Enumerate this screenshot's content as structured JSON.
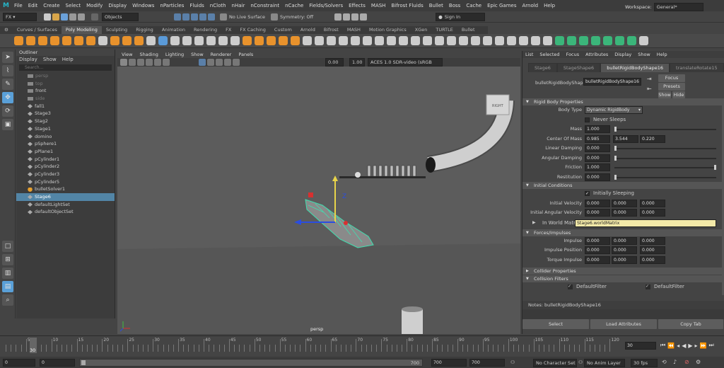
{
  "menubar": [
    "File",
    "Edit",
    "Create",
    "Select",
    "Modify",
    "Display",
    "Windows",
    "nParticles",
    "Fluids",
    "nCloth",
    "nHair",
    "nConstraint",
    "nCache",
    "Fields/Solvers",
    "Effects",
    "MASH",
    "Bifrost Fluids",
    "Bullet",
    "Boss",
    "Cache",
    "Epic Games",
    "Arnold",
    "Help"
  ],
  "workspace": {
    "label": "Workspace:",
    "value": "General*"
  },
  "status": {
    "mode": "FX",
    "objects": "Objects",
    "live_surface": "No Live Surface",
    "symmetry": "Symmetry: Off",
    "sign_in": "Sign In"
  },
  "shelf_tabs": [
    "Curves / Surfaces",
    "Poly Modeling",
    "Sculpting",
    "Rigging",
    "Animation",
    "Rendering",
    "FX",
    "FX Caching",
    "Custom",
    "Arnold",
    "Bifrost",
    "MASH",
    "Motion Graphics",
    "XGen",
    "TURTLE",
    "Bullet"
  ],
  "shelf_active": "Poly Modeling",
  "outliner": {
    "title": "Outliner",
    "menus": [
      "Display",
      "Show",
      "Help"
    ],
    "search_placeholder": "Search...",
    "items": [
      {
        "label": "persp",
        "dim": true
      },
      {
        "label": "top",
        "dim": true
      },
      {
        "label": "front",
        "dim": false
      },
      {
        "label": "side",
        "dim": true
      },
      {
        "label": "fall1",
        "dim": false
      },
      {
        "label": "Stage3",
        "dim": false
      },
      {
        "label": "Stag2",
        "dim": false
      },
      {
        "label": "Stage1",
        "dim": false
      },
      {
        "label": "domino",
        "dim": false
      },
      {
        "label": "pSphere1",
        "dim": false
      },
      {
        "label": "pPlane1",
        "dim": false
      },
      {
        "label": "pCylinder1",
        "dim": false
      },
      {
        "label": "pCylinder2",
        "dim": false
      },
      {
        "label": "pCylinder3",
        "dim": false
      },
      {
        "label": "pCylinder5",
        "dim": false
      },
      {
        "label": "bulletSolver1",
        "dim": false
      },
      {
        "label": "Stage6",
        "dim": false,
        "selected": true
      },
      {
        "label": "defaultLightSet",
        "dim": false
      },
      {
        "label": "defaultObjectSet",
        "dim": false
      }
    ]
  },
  "viewport": {
    "menus": [
      "View",
      "Shading",
      "Lighting",
      "Show",
      "Renderer",
      "Panels"
    ],
    "field1": "0.00",
    "field2": "1.00",
    "colorspace": "ACES 1.0 SDR-video (sRGB",
    "camera_label": "persp",
    "cube_label": "RIGHT"
  },
  "attr": {
    "menus": [
      "List",
      "Selected",
      "Focus",
      "Attributes",
      "Display",
      "Show",
      "Help"
    ],
    "tabs": [
      "Stage6",
      "StageShape6",
      "bulletRigidBodyShape16",
      "translateRotate15",
      "lambert1"
    ],
    "active_tab": "bulletRigidBodyShape16",
    "node_label": "bulletRigidBodyShape:",
    "node_value": "bulletRigidBodyShape16",
    "focus": "Focus",
    "presets": "Presets",
    "show": "Show",
    "hide": "Hide",
    "sections": {
      "rigid": "Rigid Body Properties",
      "initial": "Initial Conditions",
      "forces": "Forces/Impulses",
      "collider": "Collider Properties",
      "filters": "Collision Filters"
    },
    "body_type_label": "Body Type",
    "body_type": "Dynamic RigidBody",
    "never_sleeps": "Never Sleeps",
    "mass": {
      "label": "Mass",
      "value": "1.000"
    },
    "center": {
      "label": "Center Of Mass",
      "x": "0.985",
      "y": "3.544",
      "z": "0.220"
    },
    "lin_damp": {
      "label": "Linear Damping",
      "value": "0.000"
    },
    "ang_damp": {
      "label": "Angular Damping",
      "value": "0.000"
    },
    "friction": {
      "label": "Friction",
      "value": "1.000"
    },
    "restitution": {
      "label": "Restitution",
      "value": "0.000"
    },
    "init_sleep": "Initially Sleeping",
    "init_vel": {
      "label": "Initial Velocity",
      "x": "0.000",
      "y": "0.000",
      "z": "0.000"
    },
    "init_ang": {
      "label": "Initial Angular Velocity",
      "x": "0.000",
      "y": "0.000",
      "z": "0.000"
    },
    "world_matrix": {
      "label": "In World Matrix",
      "value": "Stage6.worldMatrix"
    },
    "impulse": {
      "label": "Impulse",
      "x": "0.000",
      "y": "0.000",
      "z": "0.000"
    },
    "impulse_pos": {
      "label": "Impulse Position",
      "x": "0.000",
      "y": "0.000",
      "z": "0.000"
    },
    "torque": {
      "label": "Torque Impulse",
      "x": "0.000",
      "y": "0.000",
      "z": "0.000"
    },
    "filters": [
      "DefaultFilter",
      "DefaultFilter"
    ],
    "notes": "Notes:  bulletRigidBodyShape16",
    "select": "Select",
    "load": "Load Attributes",
    "copy": "Copy Tab"
  },
  "timeline": {
    "ticks": [
      "5",
      "10",
      "15",
      "20",
      "25",
      "30",
      "35",
      "40",
      "45",
      "50",
      "55",
      "60",
      "65",
      "70",
      "75",
      "80",
      "85",
      "90",
      "95",
      "100",
      "105",
      "110",
      "115",
      "120"
    ],
    "current": "30",
    "current_field": "30"
  },
  "range": {
    "start": "0",
    "start2": "0",
    "end_a": "700",
    "end_b": "700",
    "end_c": "700",
    "character_set": "No Character Set",
    "anim_layer": "No Anim Layer",
    "fps": "30 fps"
  }
}
